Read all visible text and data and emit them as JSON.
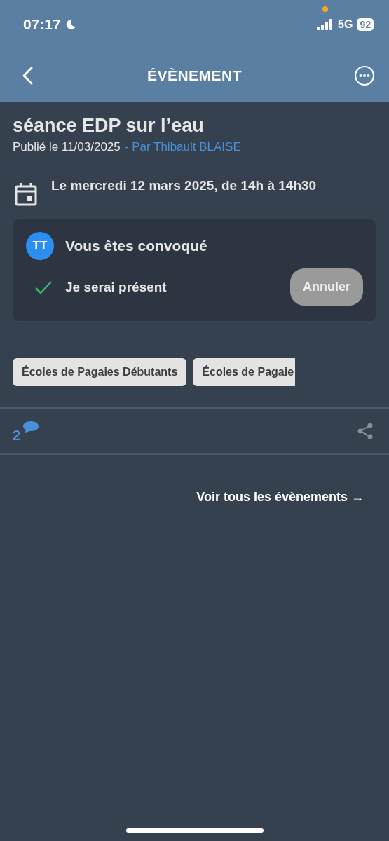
{
  "status_bar": {
    "time": "07:17",
    "network": "5G",
    "battery": "92"
  },
  "header": {
    "title": "ÉVÈNEMENT"
  },
  "event": {
    "title": "séance EDP sur l’eau",
    "published": "Publié le 11/03/2025",
    "author": "- Par Thibault BLAISE",
    "date": "Le mercredi 12 mars 2025, de 14h à 14h30"
  },
  "convocation": {
    "avatar": "TT",
    "title": "Vous êtes convoqué",
    "response": "Je serai présent",
    "confirmed": true,
    "button": "Annuler"
  },
  "tags": [
    "Écoles de Pagaies Débutants",
    "Écoles de Pagaie"
  ],
  "comments": {
    "count": "2"
  },
  "link": "Voir tous les évènements →"
}
